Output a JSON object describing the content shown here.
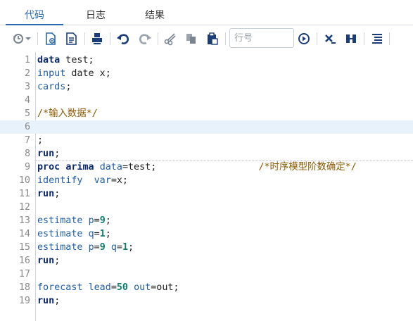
{
  "tabs": [
    {
      "label": "代码",
      "active": true
    },
    {
      "label": "日志",
      "active": false
    },
    {
      "label": "结果",
      "active": false
    }
  ],
  "toolbar": {
    "line_placeholder": "行号",
    "icons": [
      "history-icon",
      "run-icon",
      "save-icon",
      "print-icon",
      "undo-icon",
      "redo-icon",
      "cut-icon",
      "copy-icon",
      "paste-icon",
      "go-to-line-icon",
      "clear-icon",
      "split-icon",
      "format-code-icon"
    ]
  },
  "editor": {
    "current_line": 6,
    "lines": [
      {
        "n": "1",
        "tokens": [
          {
            "t": "data",
            "c": "kw"
          },
          {
            "t": " test;",
            "c": "tx"
          }
        ]
      },
      {
        "n": "2",
        "tokens": [
          {
            "t": "input",
            "c": "fn"
          },
          {
            "t": " date x;",
            "c": "tx"
          }
        ]
      },
      {
        "n": "3",
        "tokens": [
          {
            "t": "cards",
            "c": "fn"
          },
          {
            "t": ";",
            "c": "tx"
          }
        ]
      },
      {
        "n": "4",
        "tokens": []
      },
      {
        "n": "5",
        "tokens": [
          {
            "t": "/*输入数据*/",
            "c": "cm"
          }
        ]
      },
      {
        "n": "6",
        "tokens": []
      },
      {
        "n": "7",
        "tokens": [
          {
            "t": ";",
            "c": "tx"
          }
        ]
      },
      {
        "n": "8",
        "tokens": [
          {
            "t": "run",
            "c": "kw"
          },
          {
            "t": ";",
            "c": "tx"
          }
        ]
      },
      {
        "n": "9",
        "tokens": [
          {
            "t": "proc",
            "c": "kw"
          },
          {
            "t": " ",
            "c": "tx"
          },
          {
            "t": "arima",
            "c": "kw"
          },
          {
            "t": " ",
            "c": "tx"
          },
          {
            "t": "data",
            "c": "fn"
          },
          {
            "t": "=test;",
            "c": "tx"
          },
          {
            "t": "                  ",
            "c": "tx"
          },
          {
            "t": "/*时序模型阶数确定*/",
            "c": "cm"
          }
        ]
      },
      {
        "n": "10",
        "tokens": [
          {
            "t": "identify",
            "c": "fn"
          },
          {
            "t": "  ",
            "c": "tx"
          },
          {
            "t": "var",
            "c": "fn"
          },
          {
            "t": "=x;",
            "c": "tx"
          }
        ]
      },
      {
        "n": "11",
        "tokens": [
          {
            "t": "run",
            "c": "kw"
          },
          {
            "t": ";",
            "c": "tx"
          }
        ]
      },
      {
        "n": "12",
        "tokens": []
      },
      {
        "n": "13",
        "tokens": [
          {
            "t": "estimate",
            "c": "fn"
          },
          {
            "t": " ",
            "c": "tx"
          },
          {
            "t": "p",
            "c": "fn"
          },
          {
            "t": "=",
            "c": "tx"
          },
          {
            "t": "9",
            "c": "num"
          },
          {
            "t": ";",
            "c": "tx"
          }
        ]
      },
      {
        "n": "14",
        "tokens": [
          {
            "t": "estimate",
            "c": "fn"
          },
          {
            "t": " ",
            "c": "tx"
          },
          {
            "t": "q",
            "c": "fn"
          },
          {
            "t": "=",
            "c": "tx"
          },
          {
            "t": "1",
            "c": "num"
          },
          {
            "t": ";",
            "c": "tx"
          }
        ]
      },
      {
        "n": "15",
        "tokens": [
          {
            "t": "estimate",
            "c": "fn"
          },
          {
            "t": " ",
            "c": "tx"
          },
          {
            "t": "p",
            "c": "fn"
          },
          {
            "t": "=",
            "c": "tx"
          },
          {
            "t": "9",
            "c": "num"
          },
          {
            "t": " ",
            "c": "tx"
          },
          {
            "t": "q",
            "c": "fn"
          },
          {
            "t": "=",
            "c": "tx"
          },
          {
            "t": "1",
            "c": "num"
          },
          {
            "t": ";",
            "c": "tx"
          }
        ]
      },
      {
        "n": "16",
        "tokens": [
          {
            "t": "run",
            "c": "kw"
          },
          {
            "t": ";",
            "c": "tx"
          }
        ]
      },
      {
        "n": "17",
        "tokens": []
      },
      {
        "n": "18",
        "tokens": [
          {
            "t": "forecast",
            "c": "fn"
          },
          {
            "t": " ",
            "c": "tx"
          },
          {
            "t": "lead",
            "c": "fn"
          },
          {
            "t": "=",
            "c": "tx"
          },
          {
            "t": "50",
            "c": "num"
          },
          {
            "t": " ",
            "c": "tx"
          },
          {
            "t": "out",
            "c": "fn"
          },
          {
            "t": "=out;",
            "c": "tx"
          }
        ]
      },
      {
        "n": "19",
        "tokens": [
          {
            "t": "run",
            "c": "kw"
          },
          {
            "t": ";",
            "c": "tx"
          }
        ]
      }
    ]
  }
}
